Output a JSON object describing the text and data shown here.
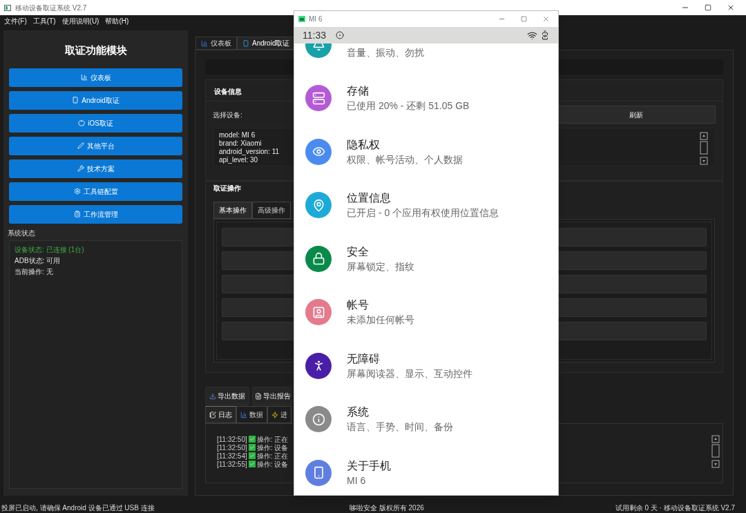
{
  "main_window": {
    "title": "移动设备取证系统 V2.7"
  },
  "menu": [
    "文件(F)",
    "工具(T)",
    "使用说明(U)",
    "帮助(H)"
  ],
  "sidebar": {
    "title": "取证功能模块",
    "buttons": [
      "仪表板",
      "Android取证",
      "iOS取证",
      "其他平台",
      "技术方案",
      "工具链配置",
      "工作流管理"
    ],
    "status_title": "系统状态",
    "status": [
      {
        "text": "设备状态: 已连接 (1台)",
        "kind": "success"
      },
      {
        "text": "ADB状态: 可用",
        "kind": "normal"
      },
      {
        "text": "当前操作: 无",
        "kind": "normal"
      }
    ]
  },
  "main_tabs": [
    {
      "label": "仪表板",
      "selected": false
    },
    {
      "label": "Android取证",
      "selected": true
    }
  ],
  "device_info": {
    "title": "设备信息",
    "select_label": "选择设备:",
    "refresh_button": "刷新",
    "details": [
      "model: MI 6",
      "brand: Xiaomi",
      "android_version: 11",
      "api_level: 30"
    ]
  },
  "operations": {
    "title": "取证操作",
    "tabs": [
      {
        "label": "基本操作",
        "selected": true
      },
      {
        "label": "高级操作",
        "selected": false
      }
    ],
    "actions": [
      {
        "kind": "button"
      },
      {
        "kind": "button"
      },
      {
        "kind": "button"
      },
      {
        "kind": "button"
      },
      {
        "kind": "button"
      }
    ]
  },
  "export_buttons": [
    "导出数据",
    "导出报告"
  ],
  "log_tabs": [
    {
      "label": "日志",
      "selected": true
    },
    {
      "label": "数据",
      "selected": false
    },
    {
      "label": "进",
      "selected": false
    }
  ],
  "log": [
    {
      "time": "[11:32:50]",
      "text": "操作: 正在"
    },
    {
      "time": "[11:32:50]",
      "text": "操作: 设备"
    },
    {
      "time": "[11:32:54]",
      "text": "操作: 正在"
    },
    {
      "time": "[11:32:55]",
      "text": "操作: 设备"
    }
  ],
  "status_bar": {
    "left": "投屏已启动, 请确保 Android 设备已通过 USB 连接",
    "center": "哆啦安全 版权所有 2026",
    "right": "试用剩余 0 天 · 移动设备取证系统 V2.7"
  },
  "phone_window": {
    "title": "MI 6",
    "time": "11:33",
    "settings": [
      {
        "subtitle": "音量、振动、勿扰",
        "color": "#17a2a8"
      },
      {
        "title": "存储",
        "subtitle": "已使用 20% - 还剩 51.05 GB",
        "color": "#b45ad6"
      },
      {
        "title": "隐私权",
        "subtitle": "权限、帐号活动、个人数据",
        "color": "#4b8bf0"
      },
      {
        "title": "位置信息",
        "subtitle": "已开启 - 0 个应用有权使用位置信息",
        "color": "#1eaad6"
      },
      {
        "title": "安全",
        "subtitle": "屏幕锁定、指纹",
        "color": "#0a8a4a"
      },
      {
        "title": "帐号",
        "subtitle": "未添加任何帐号",
        "color": "#e47a8c"
      },
      {
        "title": "无障碍",
        "subtitle": "屏幕阅读器、显示、互动控件",
        "color": "#4a1fa8"
      },
      {
        "title": "系统",
        "subtitle": "语言、手势、时间、备份",
        "color": "#8a8a8a"
      },
      {
        "title": "关于手机",
        "subtitle": "MI 6",
        "color": "#5f7fe0"
      }
    ]
  }
}
